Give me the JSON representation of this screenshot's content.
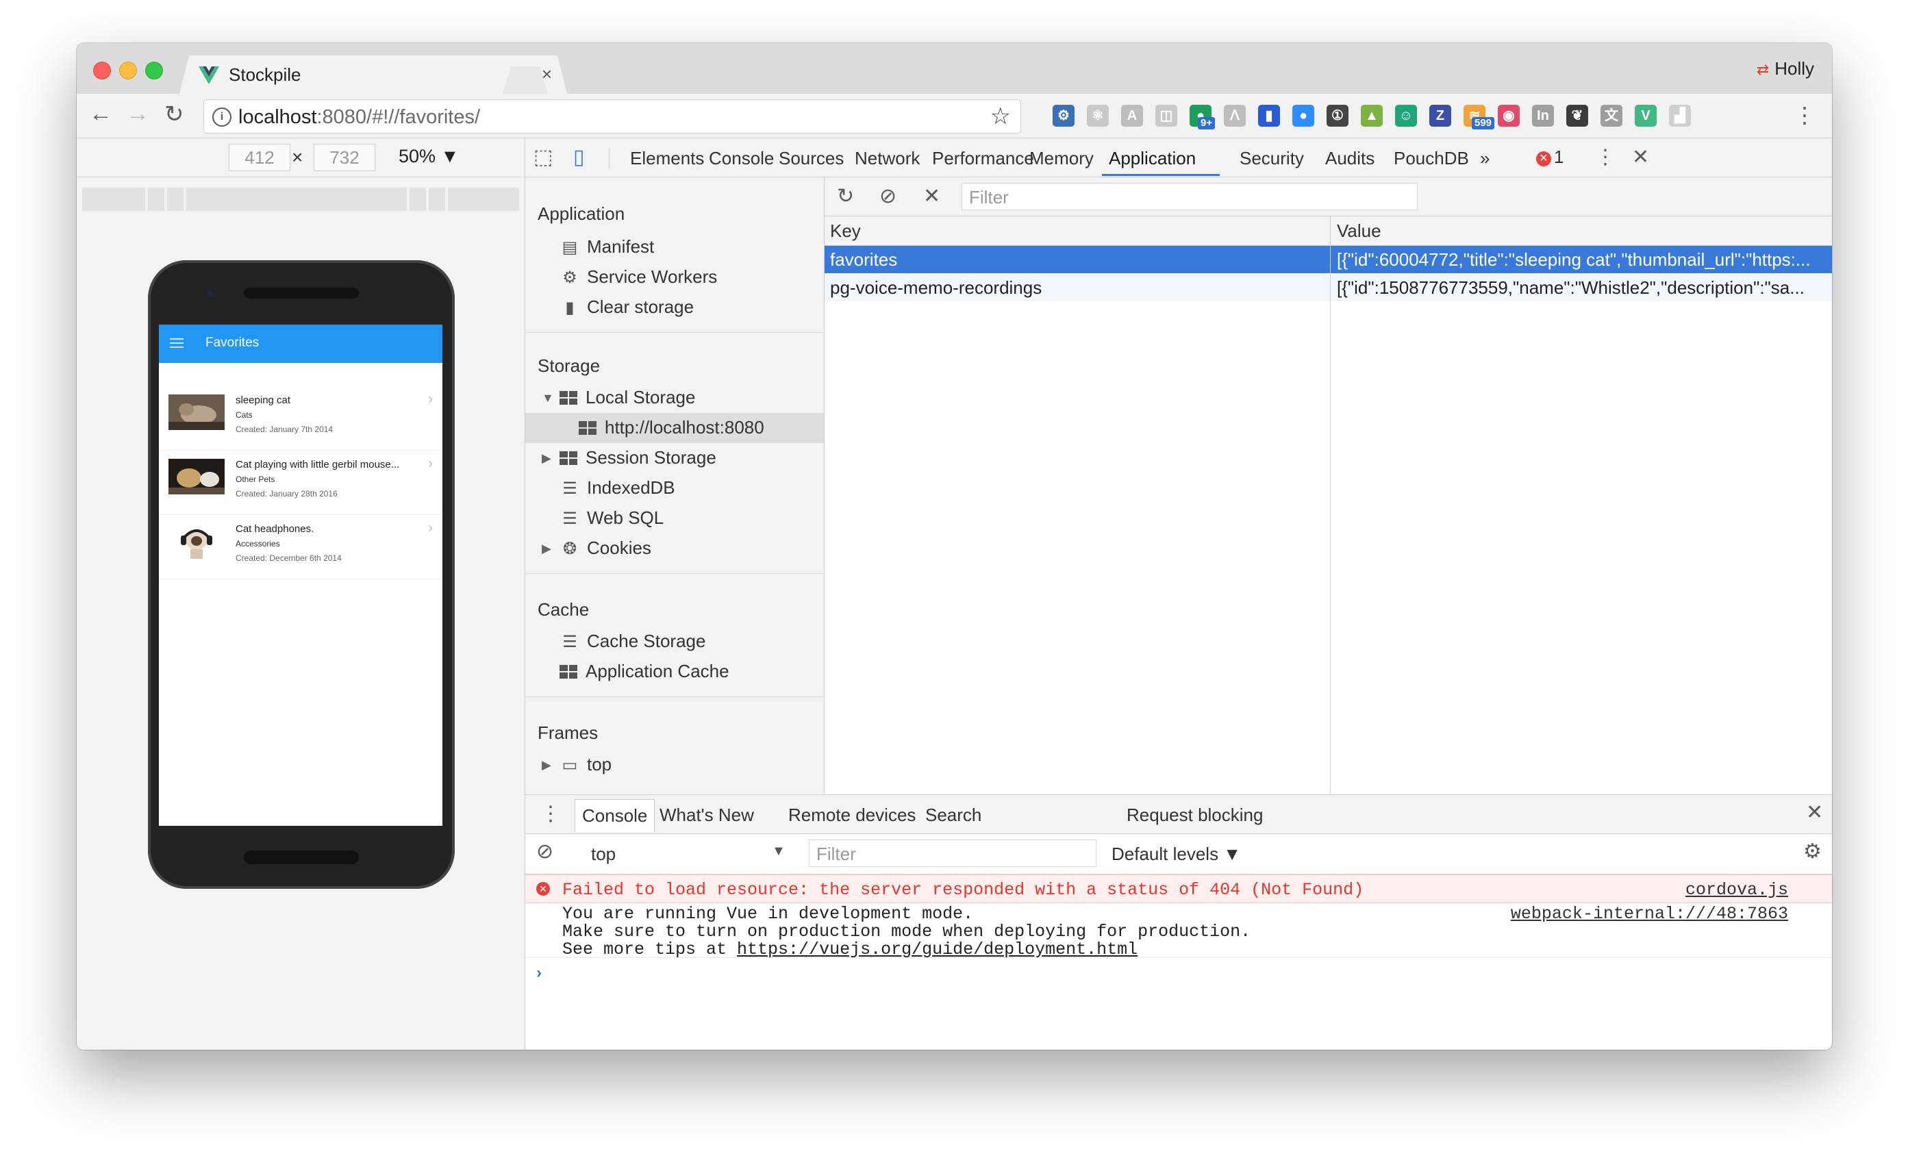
{
  "browser": {
    "tab_title": "Stockpile",
    "tab_close": "×",
    "profile_name": "Holly",
    "url_host": "localhost",
    "url_rest": ":8080/#!//favorites/",
    "extensions": [
      {
        "name": "settings-ext-icon",
        "color": "#3b6fb6",
        "glyph": "⚙"
      },
      {
        "name": "react-ext-icon",
        "color": "#c9c9c9",
        "glyph": "⚛"
      },
      {
        "name": "angular-ext-icon",
        "color": "#bdbdbd",
        "glyph": "A"
      },
      {
        "name": "grey-ext-icon",
        "color": "#c9c9c9",
        "glyph": "◫"
      },
      {
        "name": "profile-ext-icon",
        "color": "#1e9e5a",
        "glyph": "●",
        "badge": "9+"
      },
      {
        "name": "rabbit-ext-icon",
        "color": "#bdbdbd",
        "glyph": "ᐱ"
      },
      {
        "name": "ruler-ext-icon",
        "color": "#2a5bd7",
        "glyph": "▮"
      },
      {
        "name": "zoom-ext-icon",
        "color": "#2d8cff",
        "glyph": "●"
      },
      {
        "name": "onepassword-ext-icon",
        "color": "#444444",
        "glyph": "①"
      },
      {
        "name": "android-ext-icon",
        "color": "#7cb342",
        "glyph": "▲"
      },
      {
        "name": "smile-ext-icon",
        "color": "#1fa57a",
        "glyph": "☺"
      },
      {
        "name": "z-ext-icon",
        "color": "#3a4fa6",
        "glyph": "Z"
      },
      {
        "name": "rss-ext-icon",
        "color": "#f2a23a",
        "glyph": "≋",
        "badge": "599"
      },
      {
        "name": "camera-ext-icon",
        "color": "#e14a6a",
        "glyph": "◉"
      },
      {
        "name": "in-ext-icon",
        "color": "#a0a0a0",
        "glyph": "In"
      },
      {
        "name": "evernote-ext-icon",
        "color": "#3c3c3c",
        "glyph": "❦"
      },
      {
        "name": "translate-ext-icon",
        "color": "#9e9e9e",
        "glyph": "文"
      },
      {
        "name": "vue-ext-icon",
        "color": "#41b883",
        "glyph": "V"
      },
      {
        "name": "chart-ext-icon",
        "color": "#d0d0d0",
        "glyph": "▟"
      }
    ]
  },
  "device_toolbar": {
    "width": "412",
    "times": "×",
    "height": "732",
    "zoom": "50%"
  },
  "app": {
    "title": "Favorites",
    "favorites": [
      {
        "title": "sleeping cat",
        "category": "Cats",
        "created": "Created: January 7th 2014"
      },
      {
        "title": "Cat playing with little gerbil mouse...",
        "category": "Other Pets",
        "created": "Created: January 28th 2016"
      },
      {
        "title": "Cat headphones.",
        "category": "Accessories",
        "created": "Created: December 6th 2014"
      }
    ]
  },
  "devtools": {
    "tabs": [
      "Elements",
      "Console",
      "Sources",
      "Network",
      "Performance",
      "Memory",
      "Application",
      "Security",
      "Audits",
      "PouchDB"
    ],
    "active_tab": "Application",
    "more": "»",
    "error_count": "1",
    "sidebar": {
      "application_header": "Application",
      "application_items": [
        "Manifest",
        "Service Workers",
        "Clear storage"
      ],
      "storage_header": "Storage",
      "local_storage": "Local Storage",
      "local_storage_origin": "http://localhost:8080",
      "storage_items": [
        "Session Storage",
        "IndexedDB",
        "Web SQL",
        "Cookies"
      ],
      "cache_header": "Cache",
      "cache_items": [
        "Cache Storage",
        "Application Cache"
      ],
      "frames_header": "Frames",
      "frames_item": "top"
    },
    "storage_filter_placeholder": "Filter",
    "table": {
      "key_header": "Key",
      "value_header": "Value",
      "rows": [
        {
          "key": "favorites",
          "value": "[{\"id\":60004772,\"title\":\"sleeping cat\",\"thumbnail_url\":\"https:..."
        },
        {
          "key": "pg-voice-memo-recordings",
          "value": "[{\"id\":1508776773559,\"name\":\"Whistle2\",\"description\":\"sa..."
        }
      ]
    }
  },
  "drawer": {
    "tabs": [
      "Console",
      "What's New",
      "Remote devices",
      "Search",
      "Request blocking"
    ],
    "context": "top",
    "filter_placeholder": "Filter",
    "levels": "Default levels ▼",
    "error_message": "Failed to load resource: the server responded with a status of 404 (Not Found)",
    "error_source": "cordova.js",
    "log_line1": "You are running Vue in development mode.",
    "log_line2": "Make sure to turn on production mode when deploying for production.",
    "log_line3_prefix": "See more tips at ",
    "log_line3_link": "https://vuejs.org/guide/deployment.html",
    "log_source": "webpack-internal:///48:7863",
    "prompt": "›"
  }
}
